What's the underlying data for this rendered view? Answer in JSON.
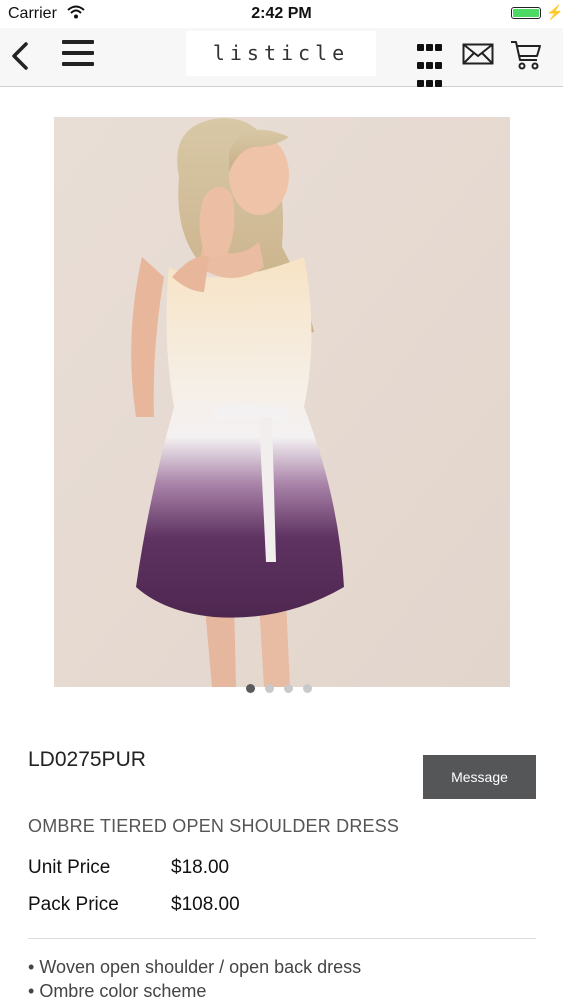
{
  "status_bar": {
    "carrier": "Carrier",
    "time": "2:42 PM"
  },
  "nav": {
    "logo_text": "listicle",
    "icons": [
      "back-icon",
      "menu-icon",
      "grid-icon",
      "mail-icon",
      "cart-icon"
    ]
  },
  "carousel": {
    "page_count": 4,
    "active_index": 0
  },
  "product": {
    "sku": "LD0275PUR",
    "message_label": "Message",
    "name": "OMBRE TIERED OPEN SHOULDER DRESS",
    "unit_price_label": "Unit Price",
    "unit_price": "$18.00",
    "pack_price_label": "Pack Price",
    "pack_price": "$108.00",
    "features": [
      "Woven open shoulder / open back dress",
      "Ombre color scheme"
    ]
  },
  "colors": {
    "battery": "#4cd964",
    "message_button": "#555657",
    "nav_background": "#f7f7f7",
    "dress_top": "#f7e3c4",
    "dress_bottom": "#4e2750"
  }
}
